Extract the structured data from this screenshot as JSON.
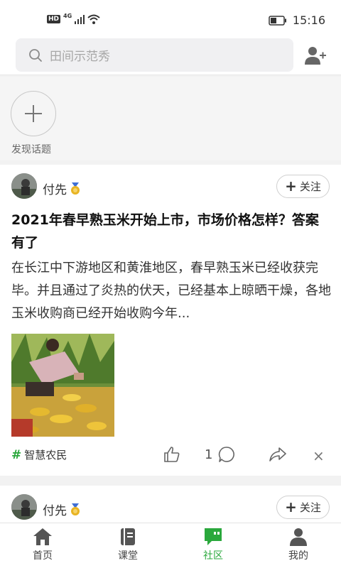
{
  "status_bar": {
    "hd": "HD",
    "network": "4G",
    "time": "15:16"
  },
  "search": {
    "placeholder": "田间示范秀"
  },
  "topics": {
    "discover_label": "发现话题"
  },
  "posts": [
    {
      "author": "付先",
      "follow_label": "关注",
      "title": "2021年春早熟玉米开始上市，市场价格怎样？答案有了",
      "summary": "在长江中下游地区和黄淮地区，春早熟玉米已经收获完毕。并且通过了炎热的伏天，已经基本上晾晒干燥，各地玉米收购商已经开始收购今年...",
      "tag": "智慧农民",
      "comment_count": "1"
    },
    {
      "author": "付先",
      "follow_label": "关注"
    }
  ],
  "tabs": [
    {
      "label": "首页",
      "icon": "home-icon"
    },
    {
      "label": "课堂",
      "icon": "book-icon"
    },
    {
      "label": "社区",
      "icon": "chat-quote-icon"
    },
    {
      "label": "我的",
      "icon": "person-icon"
    }
  ],
  "colors": {
    "accent": "#2aa83c",
    "badge_gold": "#e8b423",
    "badge_blue": "#3f6fd6"
  }
}
